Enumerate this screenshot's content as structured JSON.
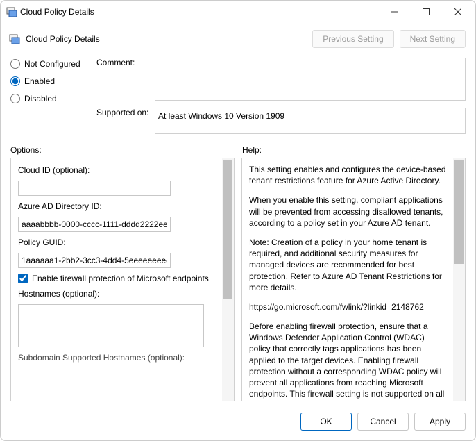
{
  "window": {
    "title": "Cloud Policy Details"
  },
  "header": {
    "subtitle": "Cloud Policy Details",
    "buttons": {
      "previous": "Previous Setting",
      "next": "Next Setting"
    }
  },
  "state": {
    "radios": {
      "not_configured": "Not Configured",
      "enabled": "Enabled",
      "disabled": "Disabled",
      "selected": "enabled"
    },
    "comment_label": "Comment:",
    "comment_value": "",
    "supported_label": "Supported on:",
    "supported_value": "At least Windows 10 Version 1909"
  },
  "sections": {
    "options_label": "Options:",
    "help_label": "Help:"
  },
  "options": {
    "cloud_id_label": "Cloud ID (optional):",
    "cloud_id_value": "",
    "directory_id_label": "Azure AD Directory ID:",
    "directory_id_value": "aaaabbbb-0000-cccc-1111-dddd2222ee",
    "policy_guid_label": "Policy GUID:",
    "policy_guid_value": "1aaaaaa1-2bb2-3cc3-4dd4-5eeeeeeeeee",
    "firewall_checkbox_label": "Enable firewall protection of Microsoft endpoints",
    "firewall_checked": true,
    "hostnames_label": "Hostnames (optional):",
    "hostnames_value": "",
    "subdomain_label": "Subdomain Supported Hostnames (optional):"
  },
  "help": {
    "p1": "This setting enables and configures the device-based tenant restrictions feature for Azure Active Directory.",
    "p2": "When you enable this setting, compliant applications will be prevented from accessing disallowed tenants, according to a policy set in your Azure AD tenant.",
    "p3": "Note: Creation of a policy in your home tenant is required, and additional security measures for managed devices are recommended for best protection. Refer to Azure AD Tenant Restrictions for more details.",
    "p4": "https://go.microsoft.com/fwlink/?linkid=2148762",
    "p5": "Before enabling firewall protection, ensure that a Windows Defender Application Control (WDAC) policy that correctly tags applications has been applied to the target devices. Enabling firewall protection without a corresponding WDAC policy will prevent all applications from reaching Microsoft endpoints. This firewall setting is not supported on all versions of Windows - see the following link for more"
  },
  "footer": {
    "ok": "OK",
    "cancel": "Cancel",
    "apply": "Apply"
  }
}
